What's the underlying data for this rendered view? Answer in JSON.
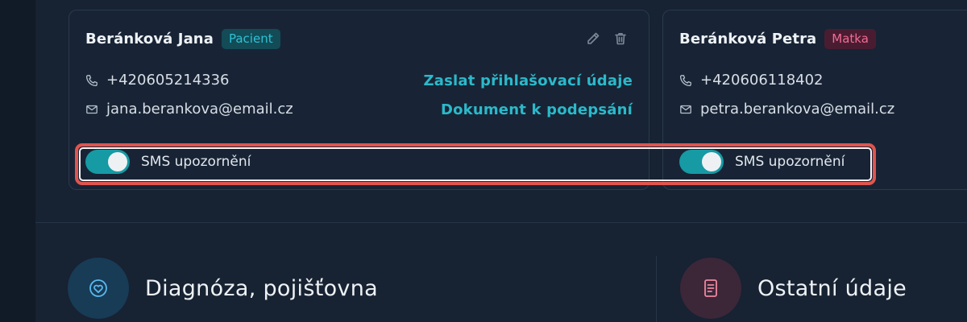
{
  "contacts": [
    {
      "name": "Beránková Jana",
      "role_badge": "Pacient",
      "phone": "+420605214336",
      "email": "jana.berankova@email.cz",
      "links": {
        "send_login": "Zaslat přihlašovací údaje",
        "document_to_sign": "Dokument k podepsání"
      },
      "sms_label": "SMS upozornění",
      "sms_enabled": true
    },
    {
      "name": "Beránková Petra",
      "role_badge": "Matka",
      "phone": "+420606118402",
      "email": "petra.berankova@email.cz",
      "sms_label": "SMS upozornění",
      "sms_enabled": true
    }
  ],
  "sections": [
    {
      "title": "Diagnóza, pojišťovna",
      "icon": "heart-icon"
    },
    {
      "title": "Ostatní údaje",
      "icon": "document-icon"
    }
  ],
  "colors": {
    "accent_teal": "#2bb9ca",
    "toggle_on": "#169aa4",
    "badge_patient": "#2ec2d4",
    "badge_mother": "#f06c94",
    "highlight": "#e0554f"
  }
}
